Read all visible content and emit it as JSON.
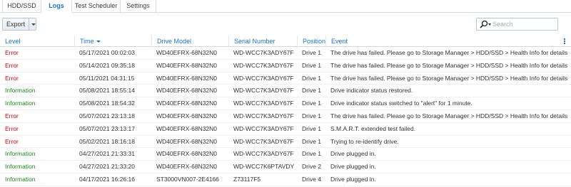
{
  "tabs": [
    {
      "label": "HDD/SSD",
      "active": false
    },
    {
      "label": "Logs",
      "active": true
    },
    {
      "label": "Test Scheduler",
      "active": false
    },
    {
      "label": "Settings",
      "active": false
    }
  ],
  "toolbar": {
    "export_label": "Export",
    "search_placeholder": "Search"
  },
  "columns": [
    "Level",
    "Time",
    "Drive Model",
    "Serial Number",
    "Position",
    "Event"
  ],
  "sort_column": "Time",
  "colors": {
    "accent": "#1a75c9",
    "error": "#d7000f",
    "information": "#1b8a1b"
  },
  "rows": [
    {
      "level": "Error",
      "time": "05/17/2021 00:02:03",
      "model": "WD40EFRX-68N32N0",
      "serial": "WD-WCC7K3ADY67F",
      "position": "Drive 1",
      "event": "The drive has failed. Please go to Storage Manager > HDD/SSD > Health Info for details."
    },
    {
      "level": "Error",
      "time": "05/14/2021 09:35:18",
      "model": "WD40EFRX-68N32N0",
      "serial": "WD-WCC7K3ADY67F",
      "position": "Drive 1",
      "event": "The drive has failed. Please go to Storage Manager > HDD/SSD > Health Info for details."
    },
    {
      "level": "Error",
      "time": "05/11/2021 04:31:15",
      "model": "WD40EFRX-68N32N0",
      "serial": "WD-WCC7K3ADY67F",
      "position": "Drive 1",
      "event": "The drive has failed. Please go to Storage Manager > HDD/SSD > Health Info for details."
    },
    {
      "level": "Information",
      "time": "05/08/2021 18:55:14",
      "model": "WD40EFRX-68N32N0",
      "serial": "WD-WCC7K3ADY67F",
      "position": "Drive 1",
      "event": "Drive indicator status restored."
    },
    {
      "level": "Information",
      "time": "05/08/2021 18:54:32",
      "model": "WD40EFRX-68N32N0",
      "serial": "WD-WCC7K3ADY67F",
      "position": "Drive 1",
      "event": "Drive indicator status switched to \"alert\" for 1 minute."
    },
    {
      "level": "Error",
      "time": "05/07/2021 23:13:18",
      "model": "WD40EFRX-68N32N0",
      "serial": "WD-WCC7K3ADY67F",
      "position": "Drive 1",
      "event": "The drive has failed. Please go to Storage Manager > HDD/SSD > Health Info for details."
    },
    {
      "level": "Error",
      "time": "05/07/2021 23:13:17",
      "model": "WD40EFRX-68N32N0",
      "serial": "WD-WCC7K3ADY67F",
      "position": "Drive 1",
      "event": "S.M.A.R.T. extended test failed."
    },
    {
      "level": "Error",
      "time": "05/02/2021 18:16:18",
      "model": "WD40EFRX-68N32N0",
      "serial": "WD-WCC7K3ADY67F",
      "position": "Drive 1",
      "event": "Trying to re-identify drive."
    },
    {
      "level": "Information",
      "time": "04/27/2021 21:33:31",
      "model": "WD40EFRX-68N32N0",
      "serial": "WD-WCC7K3ADY67F",
      "position": "Drive 1",
      "event": "Drive plugged in."
    },
    {
      "level": "Information",
      "time": "04/27/2021 21:33:20",
      "model": "WD40EFRX-68N32N0",
      "serial": "WD-WCC7K6PTAVDY",
      "position": "Drive 2",
      "event": "Drive plugged in."
    },
    {
      "level": "Information",
      "time": "04/17/2021 16:26:16",
      "model": "ST3000VN007-2E4166",
      "serial": "Z73117F5",
      "position": "Drive 4",
      "event": "Drive plugged in."
    }
  ]
}
